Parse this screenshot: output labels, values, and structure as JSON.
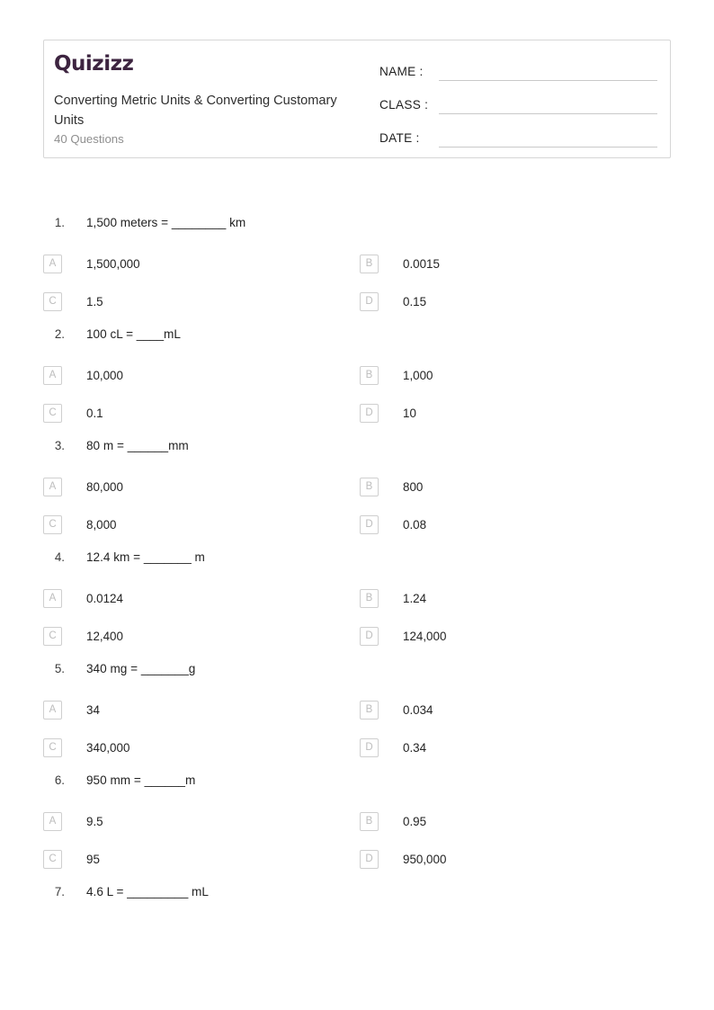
{
  "brand": {
    "logo_text": "Quizizz",
    "logo_color": "#3d2440"
  },
  "header": {
    "title": "Converting Metric Units & Converting Customary Units",
    "subtitle": "40 Questions",
    "fields": [
      {
        "label": "NAME :"
      },
      {
        "label": "CLASS :"
      },
      {
        "label": "DATE  :"
      }
    ]
  },
  "questions": [
    {
      "number": "1.",
      "text": "1,500 meters = ________ km",
      "options": [
        {
          "letter": "A",
          "text": "1,500,000"
        },
        {
          "letter": "B",
          "text": "0.0015"
        },
        {
          "letter": "C",
          "text": "1.5"
        },
        {
          "letter": "D",
          "text": "0.15"
        }
      ]
    },
    {
      "number": "2.",
      "text": "100 cL = ____mL",
      "options": [
        {
          "letter": "A",
          "text": "10,000"
        },
        {
          "letter": "B",
          "text": "1,000"
        },
        {
          "letter": "C",
          "text": "0.1"
        },
        {
          "letter": "D",
          "text": "10"
        }
      ]
    },
    {
      "number": "3.",
      "text": "80 m = ______mm",
      "options": [
        {
          "letter": "A",
          "text": "80,000"
        },
        {
          "letter": "B",
          "text": "800"
        },
        {
          "letter": "C",
          "text": "8,000"
        },
        {
          "letter": "D",
          "text": "0.08"
        }
      ]
    },
    {
      "number": "4.",
      "text": "12.4 km = _______ m",
      "options": [
        {
          "letter": "A",
          "text": "0.0124"
        },
        {
          "letter": "B",
          "text": "1.24"
        },
        {
          "letter": "C",
          "text": "12,400"
        },
        {
          "letter": "D",
          "text": "124,000"
        }
      ]
    },
    {
      "number": "5.",
      "text": "340 mg = _______g",
      "options": [
        {
          "letter": "A",
          "text": "34"
        },
        {
          "letter": "B",
          "text": "0.034"
        },
        {
          "letter": "C",
          "text": "340,000"
        },
        {
          "letter": "D",
          "text": "0.34"
        }
      ]
    },
    {
      "number": "6.",
      "text": "950 mm = ______m",
      "options": [
        {
          "letter": "A",
          "text": "9.5"
        },
        {
          "letter": "B",
          "text": "0.95"
        },
        {
          "letter": "C",
          "text": "95"
        },
        {
          "letter": "D",
          "text": "950,000"
        }
      ]
    },
    {
      "number": "7.",
      "text": "4.6 L = _________ mL",
      "options": []
    }
  ]
}
